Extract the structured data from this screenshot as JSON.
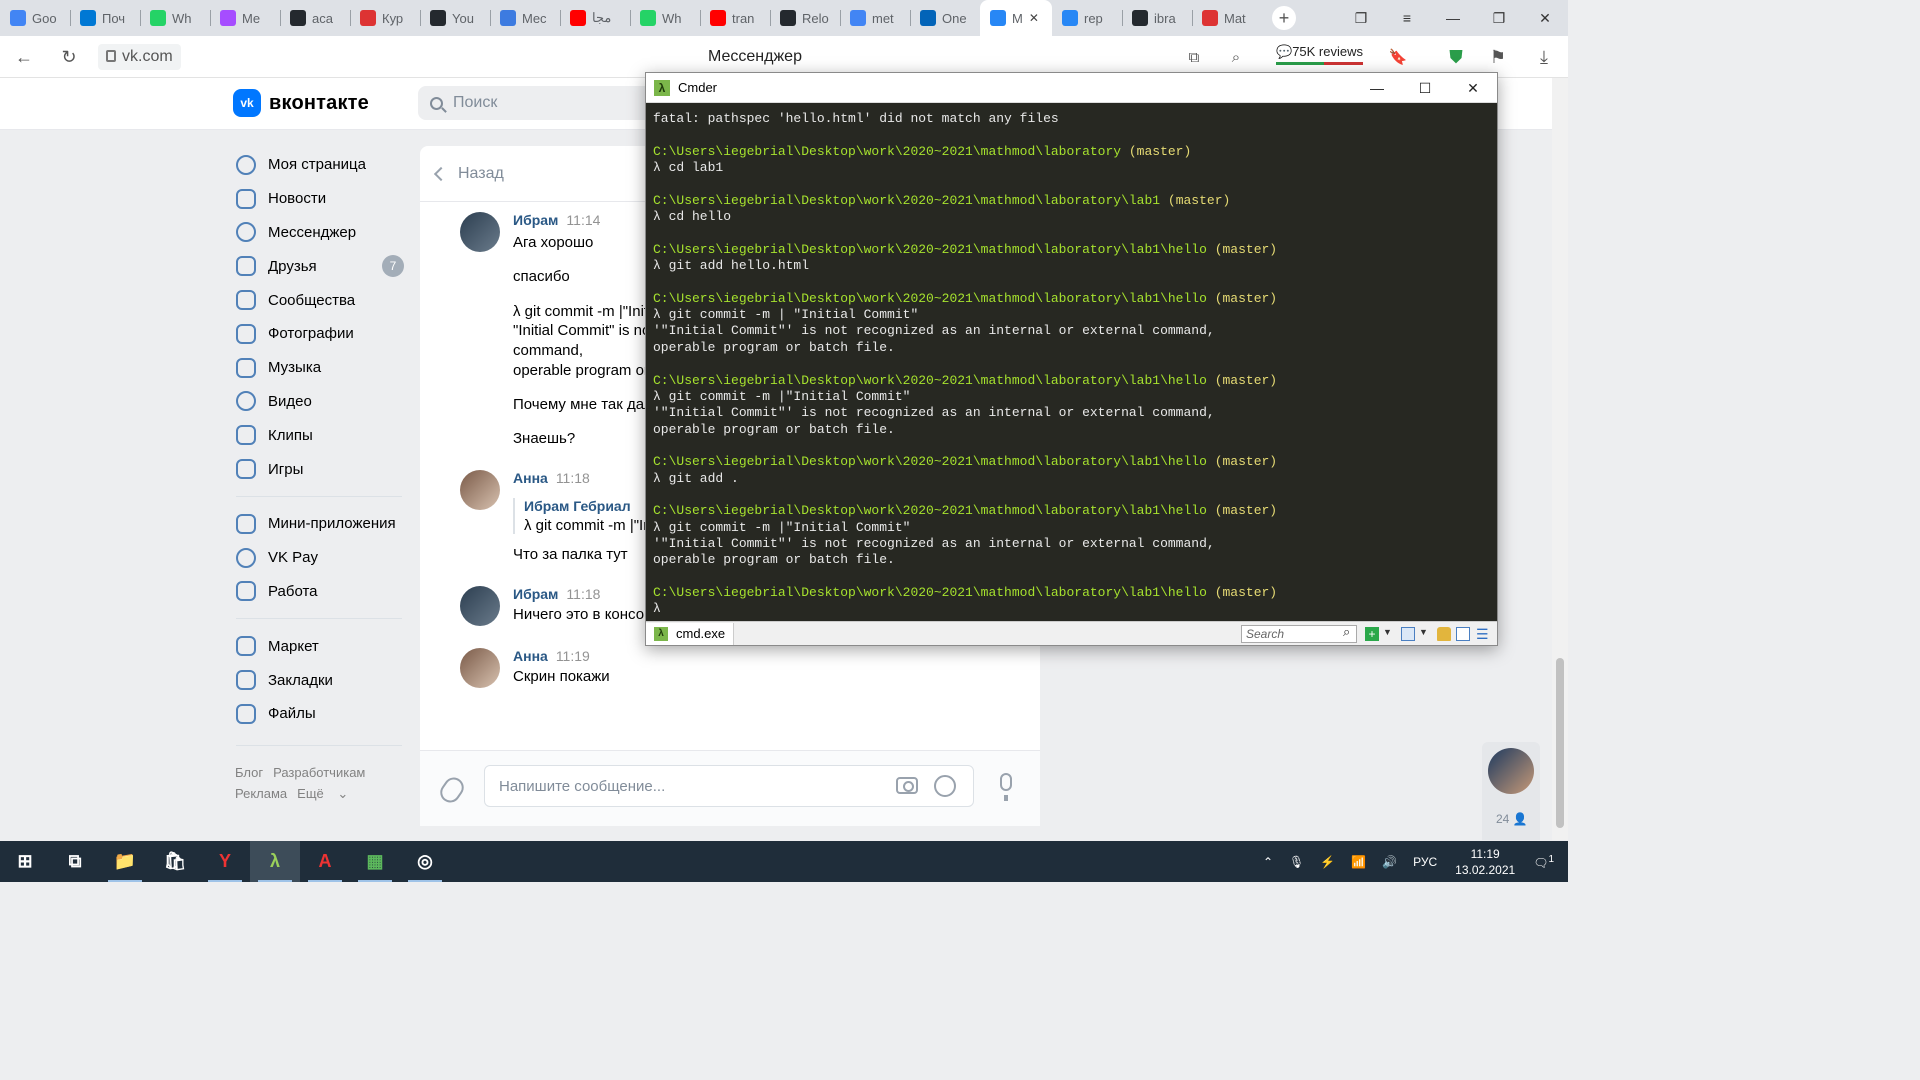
{
  "browser": {
    "tabs": [
      {
        "label": "Goo",
        "icon": "google-calendar-icon",
        "color": "#4285f4"
      },
      {
        "label": "Поч",
        "icon": "outlook-icon",
        "color": "#0078d4"
      },
      {
        "label": "Wh",
        "icon": "whatsapp-icon",
        "color": "#25d366"
      },
      {
        "label": "Me",
        "icon": "messenger-icon",
        "color": "#a64dff"
      },
      {
        "label": "aca",
        "icon": "github-icon",
        "color": "#24292e"
      },
      {
        "label": "Кур",
        "icon": "course-icon",
        "color": "#d33"
      },
      {
        "label": "You",
        "icon": "github-icon",
        "color": "#24292e"
      },
      {
        "label": "Mec",
        "icon": "chat-icon",
        "color": "#3d7be0"
      },
      {
        "label": "مجا",
        "icon": "youtube-icon",
        "color": "#ff0000"
      },
      {
        "label": "Wh",
        "icon": "whatsapp-icon",
        "color": "#25d366"
      },
      {
        "label": "tran",
        "icon": "youtube-icon",
        "color": "#ff0000"
      },
      {
        "label": "Relo",
        "icon": "github-icon",
        "color": "#24292e"
      },
      {
        "label": "met",
        "icon": "google-icon",
        "color": "#4285f4"
      },
      {
        "label": "One",
        "icon": "onedrive-icon",
        "color": "#0364b8"
      },
      {
        "label": "M",
        "icon": "chat-icon",
        "color": "#2787f5",
        "active": true
      },
      {
        "label": "rep",
        "icon": "vk-icon",
        "color": "#2787f5"
      },
      {
        "label": "ibra",
        "icon": "github-icon",
        "color": "#24292e"
      },
      {
        "label": "Mat",
        "icon": "mail-icon",
        "color": "#d33"
      }
    ],
    "url": "vk.com",
    "page_title": "Мессенджер",
    "reviews_label": "75K reviews"
  },
  "vk": {
    "logo_text": "вконтакте",
    "logo_mark": "vk",
    "search_placeholder": "Поиск",
    "menu": [
      {
        "label": "Моя страница",
        "icon": "user-icon"
      },
      {
        "label": "Новости",
        "icon": "news-icon"
      },
      {
        "label": "Мессенджер",
        "icon": "message-icon"
      },
      {
        "label": "Друзья",
        "icon": "friends-icon",
        "badge": "7"
      },
      {
        "label": "Сообщества",
        "icon": "groups-icon"
      },
      {
        "label": "Фотографии",
        "icon": "photo-icon"
      },
      {
        "label": "Музыка",
        "icon": "music-icon"
      },
      {
        "label": "Видео",
        "icon": "video-icon"
      },
      {
        "label": "Клипы",
        "icon": "clips-icon"
      },
      {
        "label": "Игры",
        "icon": "games-icon"
      }
    ],
    "menu2": [
      {
        "label": "Мини-приложения",
        "icon": "apps-icon"
      },
      {
        "label": "VK Pay",
        "icon": "vkpay-icon"
      },
      {
        "label": "Работа",
        "icon": "work-icon"
      }
    ],
    "menu3": [
      {
        "label": "Маркет",
        "icon": "market-icon"
      },
      {
        "label": "Закладки",
        "icon": "bookmark-icon"
      },
      {
        "label": "Файлы",
        "icon": "file-icon"
      }
    ],
    "footer": {
      "blog": "Блог",
      "dev": "Разработчикам",
      "ads": "Реклама",
      "more": "Ещё"
    },
    "chat": {
      "back_label": "Назад",
      "messages": [
        {
          "author": "Ибрам",
          "time": "11:14",
          "lines": [
            "Ага хорошо",
            "спасибо",
            "λ git commit -m |\"Init",
            "\"Initial Commit\" is no",
            "command,",
            "operable program or",
            "Почему мне так дал",
            "Знаешь?"
          ]
        },
        {
          "author": "Анна",
          "time": "11:18",
          "quote_author": "Ибрам Гебриал",
          "quote_text": "λ git commit -m |\"In",
          "lines": [
            "Что за палка тут"
          ]
        },
        {
          "author": "Ибрам",
          "time": "11:18",
          "lines": [
            "Ничего это в консо"
          ]
        },
        {
          "author": "Анна",
          "time": "11:19",
          "lines": [
            "Скрин покажи"
          ]
        }
      ],
      "input_placeholder": "Напишите сообщение..."
    },
    "online_count": "24"
  },
  "cmder": {
    "title": "Cmder",
    "tab_label": "cmd.exe",
    "search_placeholder": "Search",
    "lines": [
      {
        "t": "out",
        "text": "fatal: pathspec 'hello.html' did not match any files"
      },
      {
        "t": "blank",
        "text": ""
      },
      {
        "t": "path",
        "text": "C:\\Users\\iegebrial\\Desktop\\work\\2020~2021\\mathmod\\laboratory",
        "branch": " (master)"
      },
      {
        "t": "out",
        "text": "λ cd lab1"
      },
      {
        "t": "blank",
        "text": ""
      },
      {
        "t": "path",
        "text": "C:\\Users\\iegebrial\\Desktop\\work\\2020~2021\\mathmod\\laboratory\\lab1",
        "branch": " (master)"
      },
      {
        "t": "out",
        "text": "λ cd hello"
      },
      {
        "t": "blank",
        "text": ""
      },
      {
        "t": "path",
        "text": "C:\\Users\\iegebrial\\Desktop\\work\\2020~2021\\mathmod\\laboratory\\lab1\\hello",
        "branch": " (master)"
      },
      {
        "t": "out",
        "text": "λ git add hello.html"
      },
      {
        "t": "blank",
        "text": ""
      },
      {
        "t": "path",
        "text": "C:\\Users\\iegebrial\\Desktop\\work\\2020~2021\\mathmod\\laboratory\\lab1\\hello",
        "branch": " (master)"
      },
      {
        "t": "out",
        "text": "λ git commit -m | \"Initial Commit\""
      },
      {
        "t": "out",
        "text": "'\"Initial Commit\"' is not recognized as an internal or external command,"
      },
      {
        "t": "out",
        "text": "operable program or batch file."
      },
      {
        "t": "blank",
        "text": ""
      },
      {
        "t": "path",
        "text": "C:\\Users\\iegebrial\\Desktop\\work\\2020~2021\\mathmod\\laboratory\\lab1\\hello",
        "branch": " (master)"
      },
      {
        "t": "out",
        "text": "λ git commit -m |\"Initial Commit\""
      },
      {
        "t": "out",
        "text": "'\"Initial Commit\"' is not recognized as an internal or external command,"
      },
      {
        "t": "out",
        "text": "operable program or batch file."
      },
      {
        "t": "blank",
        "text": ""
      },
      {
        "t": "path",
        "text": "C:\\Users\\iegebrial\\Desktop\\work\\2020~2021\\mathmod\\laboratory\\lab1\\hello",
        "branch": " (master)"
      },
      {
        "t": "out",
        "text": "λ git add ."
      },
      {
        "t": "blank",
        "text": ""
      },
      {
        "t": "path",
        "text": "C:\\Users\\iegebrial\\Desktop\\work\\2020~2021\\mathmod\\laboratory\\lab1\\hello",
        "branch": " (master)"
      },
      {
        "t": "out",
        "text": "λ git commit -m |\"Initial Commit\""
      },
      {
        "t": "out",
        "text": "'\"Initial Commit\"' is not recognized as an internal or external command,"
      },
      {
        "t": "out",
        "text": "operable program or batch file."
      },
      {
        "t": "blank",
        "text": ""
      },
      {
        "t": "path",
        "text": "C:\\Users\\iegebrial\\Desktop\\work\\2020~2021\\mathmod\\laboratory\\lab1\\hello",
        "branch": " (master)"
      },
      {
        "t": "out",
        "text": "λ"
      }
    ]
  },
  "taskbar": {
    "apps": [
      "windows-start-icon",
      "task-view-icon",
      "file-explorer-icon",
      "store-icon",
      "yandex-browser-icon",
      "cmder-icon",
      "acrobat-icon",
      "spreadsheet-icon",
      "obs-icon"
    ],
    "language": "РУС",
    "time": "11:19",
    "date": "13.02.2021",
    "notifications": "1"
  },
  "colors": {
    "vk_blue": "#0077ff",
    "link": "#2a5885",
    "prompt_green": "#a6e22e",
    "branch_yellow": "#e6db74",
    "console_bg": "#272822"
  }
}
